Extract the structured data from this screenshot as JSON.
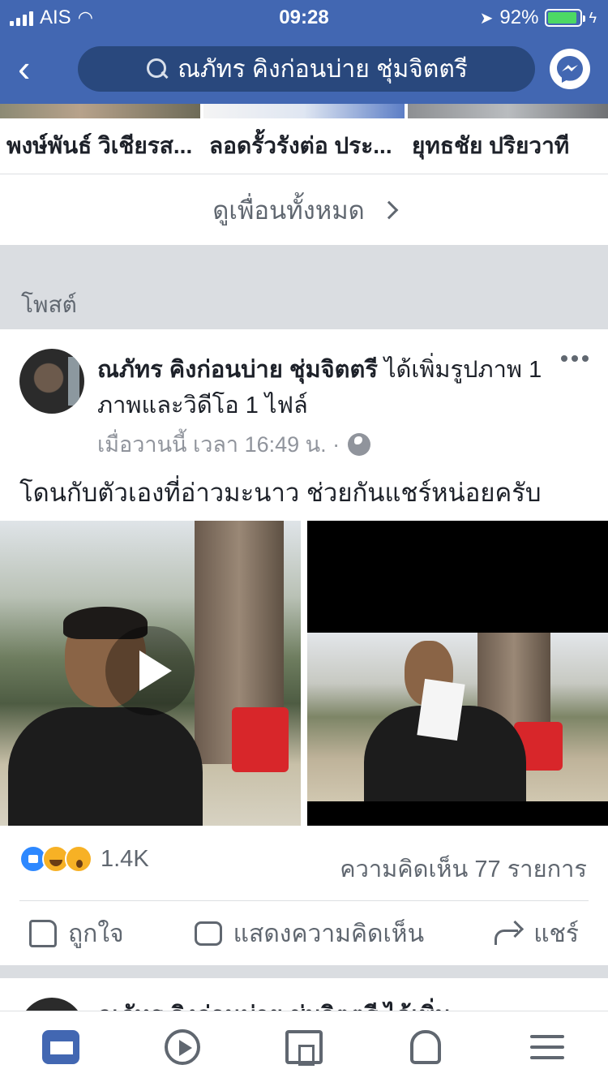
{
  "status_bar": {
    "carrier": "AIS",
    "time": "09:28",
    "battery_percent": "92%",
    "battery_level": 0.92,
    "colors": {
      "battery_fill": "#4cd964"
    }
  },
  "header": {
    "search_text": "ณภัทร คิงก่อนบ่าย ชุ่มจิตตรี",
    "back_icon": "chevron-left-icon",
    "messenger_icon": "messenger-icon",
    "color": "#4267b2"
  },
  "friends": {
    "names": [
      "พงษ์พันธ์ วิเชียรส...",
      "ลอดรั้วรังต่อ ประ...",
      "ยุทธชัย ปริยวาที"
    ],
    "see_all": "ดูเพื่อนทั้งหมด"
  },
  "section": {
    "label": "โพสต์"
  },
  "post": {
    "author": "ณภัทร คิงก่อนบ่าย ชุ่มจิตตรี",
    "action": " ได้เพิ่มรูปภาพ 1 ภาพและวิดีโอ 1 ไฟล์",
    "time": "เมื่อวานนี้ เวลา 16:49 น. ·",
    "text": "โดนกับตัวเองที่อ่าวมะนาว ช่วยกันแชร์หน่อยครับ",
    "reaction_count": "1.4K",
    "comments": "ความคิดเห็น 77 รายการ",
    "like_label": "ถูกใจ",
    "comment_label": "แสดงความคิดเห็น",
    "share_label": "แชร์"
  },
  "next_post": {
    "head": "ณภัทร คิงก่อนบ่าย ชุ่มจิตตรี ได้เพิ่ม"
  },
  "tabbar": {
    "items": [
      "news-feed-icon",
      "video-icon",
      "marketplace-icon",
      "notifications-icon",
      "menu-icon"
    ],
    "active": "news-feed-icon",
    "active_color": "#4267b2"
  }
}
